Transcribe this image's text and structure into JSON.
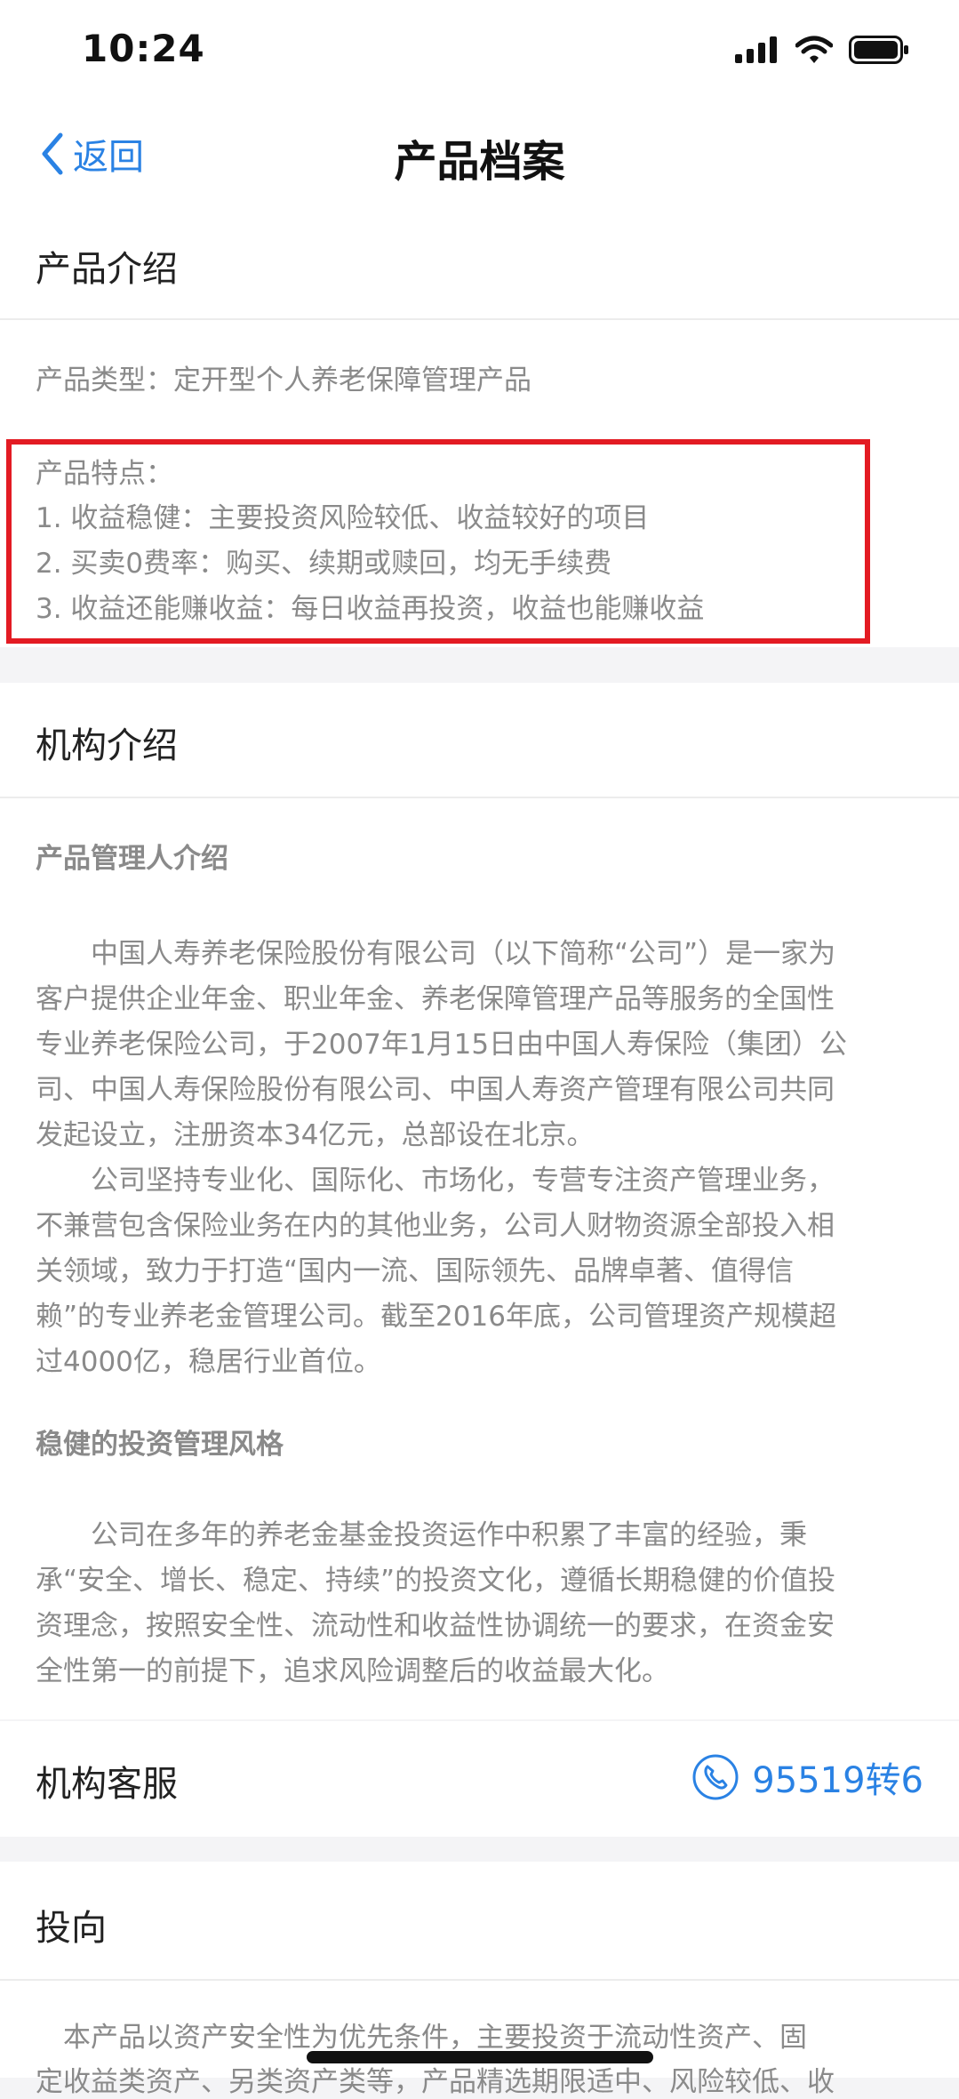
{
  "status": {
    "time": "10:24"
  },
  "nav": {
    "back_label": "返回",
    "title": "产品档案"
  },
  "product_intro": {
    "heading": "产品介绍",
    "type_line": "产品类型：定开型个人养老保障管理产品",
    "features_title": "产品特点：",
    "features": [
      "1. 收益稳健：主要投资风险较低、收益较好的项目",
      "2. 买卖0费率：购买、续期或赎回，均无手续费",
      "3. 收益还能赚收益：每日收益再投资，收益也能赚收益"
    ]
  },
  "institution": {
    "heading": "机构介绍",
    "manager_title": "产品管理人介绍",
    "manager_lines": [
      "　　中国人寿养老保险股份有限公司（以下简称“公司”）是一家为",
      "客户提供企业年金、职业年金、养老保障管理产品等服务的全国性",
      "专业养老保险公司，于2007年1月15日由中国人寿保险（集团）公",
      "司、中国人寿保险股份有限公司、中国人寿资产管理有限公司共同",
      "发起设立，注册资本34亿元，总部设在北京。",
      "　　公司坚持专业化、国际化、市场化，专营专注资产管理业务，",
      "不兼营包含保险业务在内的其他业务，公司人财物资源全部投入相",
      "关领域，致力于打造“国内一流、国际领先、品牌卓著、值得信",
      "赖”的专业养老金管理公司。截至2016年底，公司管理资产规模超",
      "过4000亿，稳居行业首位。"
    ],
    "style_title": "稳健的投资管理风格",
    "style_lines": [
      "　　公司在多年的养老金基金投资运作中积累了丰富的经验，秉",
      "承“安全、增长、稳定、持续”的投资文化，遵循长期稳健的价值投",
      "资理念，按照安全性、流动性和收益性协调统一的要求，在资金安",
      "全性第一的前提下，追求风险调整后的收益最大化。"
    ]
  },
  "service": {
    "label": "机构客服",
    "phone": "95519转6"
  },
  "direction": {
    "heading": "投向",
    "lines": [
      "　本产品以资产安全性为优先条件，主要投资于流动性资产、固",
      "定收益类资产、另类资产类等，产品精选期限适中、风险较低、收"
    ]
  },
  "colors": {
    "accent": "#2a82e4",
    "highlight": "#e31b23"
  }
}
